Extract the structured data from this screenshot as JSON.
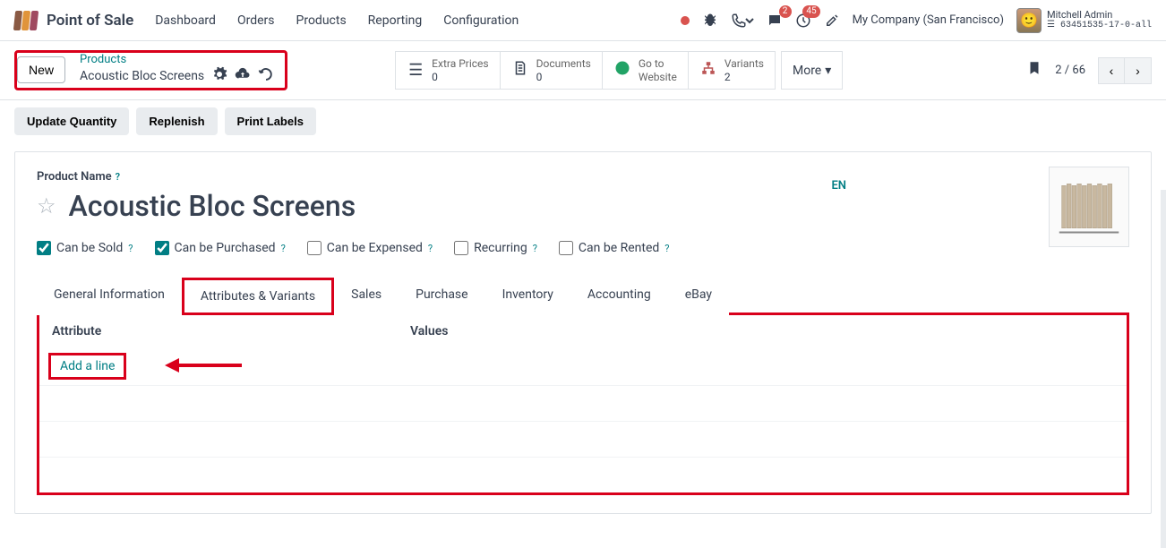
{
  "nav": {
    "app_name": "Point of Sale",
    "menu": [
      "Dashboard",
      "Orders",
      "Products",
      "Reporting",
      "Configuration"
    ]
  },
  "systray": {
    "chat_badge": "2",
    "activity_badge": "45",
    "company": "My Company (San Francisco)",
    "user_name": "Mitchell Admin",
    "db": "63451535-17-0-all"
  },
  "cp": {
    "new_label": "New",
    "breadcrumb_parent": "Products",
    "breadcrumb_current": "Acoustic Bloc Screens",
    "stats": {
      "extra_prices": {
        "label": "Extra Prices",
        "value": "0"
      },
      "documents": {
        "label": "Documents",
        "value": "0"
      },
      "goto": {
        "label_top": "Go to",
        "label_bot": "Website"
      },
      "variants": {
        "label": "Variants",
        "value": "2"
      }
    },
    "more_label": "More",
    "pager": "2 / 66"
  },
  "actions": {
    "update_qty": "Update Quantity",
    "replenish": "Replenish",
    "print_labels": "Print Labels"
  },
  "form": {
    "product_name_label": "Product Name",
    "product_title": "Acoustic Bloc Screens",
    "lang": "EN",
    "checkboxes": {
      "sold": "Can be Sold",
      "purchased": "Can be Purchased",
      "expensed": "Can be Expensed",
      "recurring": "Recurring",
      "rented": "Can be Rented"
    },
    "tabs": [
      "General Information",
      "Attributes & Variants",
      "Sales",
      "Purchase",
      "Inventory",
      "Accounting",
      "eBay"
    ],
    "table": {
      "col_attribute": "Attribute",
      "col_values": "Values",
      "add_line": "Add a line"
    }
  }
}
